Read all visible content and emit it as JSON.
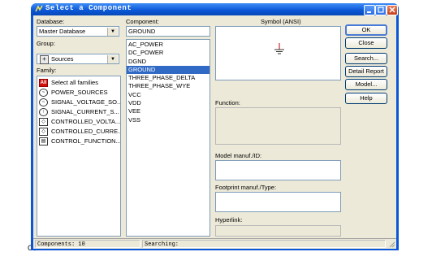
{
  "corner_label": "C、",
  "window": {
    "title": "Select a Component"
  },
  "database": {
    "label": "Database:",
    "value": "Master Database"
  },
  "group": {
    "label": "Group:",
    "value": "Sources"
  },
  "family": {
    "label": "Family:",
    "items": [
      {
        "label": "Select all families",
        "icon": "all-icon"
      },
      {
        "label": "POWER_SOURCES",
        "icon": "power-source-icon"
      },
      {
        "label": "SIGNAL_VOLTAGE_SO...",
        "icon": "voltage-source-icon"
      },
      {
        "label": "SIGNAL_CURRENT_S...",
        "icon": "current-source-icon"
      },
      {
        "label": "CONTROLLED_VOLTA...",
        "icon": "controlled-voltage-icon"
      },
      {
        "label": "CONTROLLED_CURRE...",
        "icon": "controlled-current-icon"
      },
      {
        "label": "CONTROL_FUNCTION...",
        "icon": "control-function-icon"
      }
    ]
  },
  "component": {
    "label": "Component:",
    "value": "GROUND",
    "items": [
      "AC_POWER",
      "DC_POWER",
      "DGND",
      "GROUND",
      "THREE_PHASE_DELTA",
      "THREE_PHASE_WYE",
      "VCC",
      "VDD",
      "VEE",
      "VSS"
    ],
    "selected": "GROUND"
  },
  "symbol": {
    "label": "Symbol (ANSI)",
    "icon": "ground-symbol-icon"
  },
  "function_label": "Function:",
  "model_manuf_label": "Model manuf./ID:",
  "footprint_manuf_label": "Footprint manuf./Type:",
  "hyperlink_label": "Hyperlink:",
  "buttons": {
    "ok": "OK",
    "close": "Close",
    "search": "Search...",
    "detail_report": "Detail Report",
    "model": "Model...",
    "help": "Help"
  },
  "status": {
    "components": "Components: 10",
    "searching": "Searching:"
  }
}
